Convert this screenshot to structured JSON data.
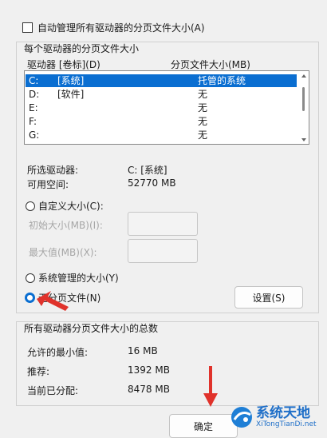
{
  "auto_manage": {
    "label": "自动管理所有驱动器的分页文件大小(A)",
    "checked": false
  },
  "per_drive": {
    "title": "每个驱动器的分页文件大小",
    "columns": {
      "drive": "驱动器 [卷标](D)",
      "size": "分页文件大小(MB)"
    },
    "rows": [
      {
        "drive": "C:",
        "label": "[系统]",
        "size": "托管的系统",
        "selected": true
      },
      {
        "drive": "D:",
        "label": "[软件]",
        "size": "无",
        "selected": false
      },
      {
        "drive": "E:",
        "label": "",
        "size": "无",
        "selected": false
      },
      {
        "drive": "F:",
        "label": "",
        "size": "无",
        "selected": false
      },
      {
        "drive": "G:",
        "label": "",
        "size": "无",
        "selected": false
      }
    ],
    "selected_drive_label": "所选驱动器:",
    "selected_drive_value": "C:  [系统]",
    "free_space_label": "可用空间:",
    "free_space_value": "52770 MB",
    "custom_size_label": "自定义大小(C):",
    "initial_size_label": "初始大小(MB)(I):",
    "max_size_label": "最大值(MB)(X):",
    "initial_size_value": "",
    "max_size_value": "",
    "system_managed_label": "系统管理的大小(Y)",
    "no_paging_label": "无分页文件(N)",
    "selected_option": "no_paging",
    "set_button": "设置(S)"
  },
  "totals": {
    "title": "所有驱动器分页文件大小的总数",
    "min_label": "允许的最小值:",
    "min_value": "16 MB",
    "recommended_label": "推荐:",
    "recommended_value": "1392 MB",
    "allocated_label": "当前已分配:",
    "allocated_value": "8478 MB"
  },
  "ok_button": "确定",
  "watermark": {
    "title": "系统天地",
    "url": "XiTongTianDi.net"
  },
  "colors": {
    "selection": "#0a6ed1",
    "arrow": "#e0322b",
    "disabled_text": "#a6a6a6"
  }
}
